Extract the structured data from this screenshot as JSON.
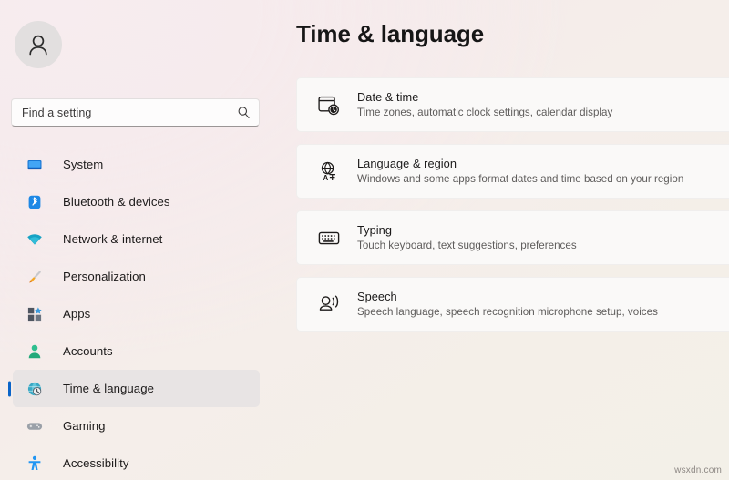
{
  "sidebar": {
    "avatar": {
      "icon": "person-avatar-icon"
    },
    "search": {
      "placeholder": "Find a setting",
      "value": "",
      "icon": "search-icon"
    },
    "items": [
      {
        "label": "System",
        "icon": "monitor-icon",
        "selected": false
      },
      {
        "label": "Bluetooth & devices",
        "icon": "bluetooth-icon",
        "selected": false
      },
      {
        "label": "Network & internet",
        "icon": "wifi-icon",
        "selected": false
      },
      {
        "label": "Personalization",
        "icon": "paintbrush-icon",
        "selected": false
      },
      {
        "label": "Apps",
        "icon": "apps-grid-icon",
        "selected": false
      },
      {
        "label": "Accounts",
        "icon": "person-icon",
        "selected": false
      },
      {
        "label": "Time & language",
        "icon": "clock-globe-icon",
        "selected": true
      },
      {
        "label": "Gaming",
        "icon": "gamepad-icon",
        "selected": false
      },
      {
        "label": "Accessibility",
        "icon": "accessibility-icon",
        "selected": false
      }
    ]
  },
  "main": {
    "title": "Time & language",
    "cards": [
      {
        "title": "Date & time",
        "subtitle": "Time zones, automatic clock settings, calendar display",
        "icon": "calendar-clock-icon"
      },
      {
        "title": "Language & region",
        "subtitle": "Windows and some apps format dates and time based on your region",
        "icon": "language-translate-icon"
      },
      {
        "title": "Typing",
        "subtitle": "Touch keyboard, text suggestions, preferences",
        "icon": "keyboard-icon"
      },
      {
        "title": "Speech",
        "subtitle": "Speech language, speech recognition microphone setup, voices",
        "icon": "speech-person-icon"
      }
    ]
  },
  "watermark": "wsxdn.com",
  "colors": {
    "accent": "#0a64c8",
    "selected_bg": "#e8e4e4",
    "card_bg": "#faf9f8",
    "text_primary": "#1b1a1a",
    "text_secondary": "#5e5c5b"
  }
}
